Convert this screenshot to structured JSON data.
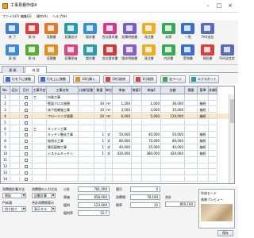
{
  "window": {
    "title": "工事見積作成4",
    "controls": {
      "minimize": "–",
      "maximize": "□",
      "close": "×"
    }
  },
  "menu": [
    "ファイル(F)",
    "編集(E)",
    "操作(A)",
    "ヘルプ(H)"
  ],
  "toolbar": {
    "row1": [
      {
        "label": "終 了",
        "color": "#3f7fd0"
      },
      {
        "label": "保 存",
        "color": "#d84040"
      },
      {
        "label": "見積書",
        "color": "#e07828"
      },
      {
        "label": "見積送付",
        "color": "#2c9aa8"
      },
      {
        "label": "請求書",
        "color": "#3a8fd8"
      },
      {
        "label": "合計請求書",
        "color": "#d03c8c"
      },
      {
        "label": "見積明細書",
        "color": "#7a5cc8"
      },
      {
        "label": "発注書",
        "color": "#e8b020"
      },
      {
        "label": "封筒",
        "color": "#38a858"
      },
      {
        "label": "一覧",
        "color": "#3a6cc8"
      },
      {
        "label": "FAX送信",
        "color": "#5a6cb8"
      }
    ],
    "row2": [
      {
        "label": "表 紙",
        "color": "#3f88d8"
      },
      {
        "label": "保 存",
        "color": "#5aa838"
      },
      {
        "label": "見積書",
        "color": "#e09020"
      },
      {
        "label": "見積原価",
        "color": "#d84880"
      },
      {
        "label": "請求書",
        "color": "#2c9aa8"
      },
      {
        "label": "合計請求書",
        "color": "#c83c3c"
      },
      {
        "label": "請求明細書",
        "color": "#8a5cc8"
      },
      {
        "label": "発注書",
        "color": "#e8b020"
      },
      {
        "label": "内訳書",
        "color": "#38a858"
      },
      {
        "label": "受領書",
        "color": "#3a6cc8"
      },
      {
        "label": "領収書",
        "color": "#d84040"
      },
      {
        "label": "FAX送信状",
        "color": "#5a6cb8"
      }
    ]
  },
  "tabs": [
    "表 紙",
    "内 容"
  ],
  "active_tab_index": 1,
  "actions": [
    {
      "label": "行を下に移動",
      "icon_color": "#3a70c8"
    },
    {
      "label": "行を上に移動",
      "icon_color": "#3a70c8"
    },
    {
      "label": "10行挿入",
      "icon_color": "#e09020"
    },
    {
      "label": "10行削除",
      "icon_color": "#d84040"
    },
    {
      "label": "1行削除",
      "icon_color": "#d84040"
    },
    {
      "label": "次ページ",
      "icon_color": "#38a858"
    },
    {
      "label": "エクスポート",
      "icon_color": "#2c9aa8"
    }
  ],
  "grid": {
    "headers": [
      "No.",
      "区分",
      "日付",
      "工事予定",
      "工事名称",
      "仕様/型番",
      "数量",
      "単位",
      "単価",
      "数量2",
      "単価2",
      "金額",
      "摘要",
      "基準",
      "非課税"
    ],
    "rows": [
      {
        "no": "1",
        "kubun": "",
        "cat": "工",
        "name": "内装工事",
        "spec": "",
        "qty": "",
        "unit": "",
        "price": "",
        "qty2": "",
        "price2": "",
        "amount": "",
        "note": "",
        "std": "",
        "tax": ""
      },
      {
        "no": "2",
        "kubun": "",
        "cat": "",
        "name": "壁面クロス張替",
        "spec": "",
        "qty": "30",
        "unit": "m²",
        "price": "1,200",
        "qty2": "",
        "price2": "1,000",
        "amount": "36,000",
        "note": "",
        "std": "継続",
        "tax": ""
      },
      {
        "no": "3",
        "kubun": "",
        "cat": "",
        "name": "床下地補強工事",
        "spec": "",
        "qty": "10",
        "unit": "m²",
        "price": "3,500",
        "qty2": "",
        "price2": "3,000",
        "amount": "35,000",
        "note": "",
        "std": "継続",
        "tax": ""
      },
      {
        "no": "4",
        "kubun": "",
        "cat": "",
        "name": "フローリング張替",
        "spec": "",
        "qty": "20",
        "unit": "m²",
        "price": "6,000",
        "qty2": "",
        "price2": "5,000",
        "amount": "120,000",
        "note": "",
        "std": "継続",
        "tax": ""
      },
      {
        "no": "5",
        "kubun": "",
        "cat": "",
        "name": "",
        "spec": "",
        "qty": "",
        "unit": "",
        "price": "",
        "qty2": "",
        "price2": "",
        "amount": "",
        "note": "",
        "std": "",
        "tax": ""
      },
      {
        "no": "6",
        "kubun": "",
        "cat": "工",
        "name": "キッチン工事",
        "spec": "",
        "qty": "",
        "unit": "",
        "price": "",
        "qty2": "",
        "price2": "",
        "amount": "",
        "note": "",
        "std": "",
        "tax": ""
      },
      {
        "no": "7",
        "kubun": "",
        "cat": "",
        "name": "キッチン撤去工事",
        "spec": "",
        "qty": "1",
        "unit": "式",
        "price": "50,000",
        "qty2": "",
        "price2": "40,000",
        "amount": "50,000",
        "note": "",
        "std": "継続",
        "tax": ""
      },
      {
        "no": "8",
        "kubun": "",
        "cat": "",
        "name": "給排水工事",
        "spec": "",
        "qty": "1",
        "unit": "式",
        "price": "80,000",
        "qty2": "",
        "price2": "70,000",
        "amount": "80,000",
        "note": "",
        "std": "継続",
        "tax": ""
      },
      {
        "no": "9",
        "kubun": "",
        "cat": "",
        "name": "電気配線工事",
        "spec": "",
        "qty": "1",
        "unit": "式",
        "price": "40,000",
        "qty2": "",
        "price2": "35,000",
        "amount": "40,000",
        "note": "",
        "std": "継続",
        "tax": ""
      },
      {
        "no": "10",
        "kubun": "",
        "cat": "",
        "name": "システムキッチン",
        "spec": "",
        "qty": "1",
        "unit": "式",
        "price": "420,000",
        "qty2": "",
        "price2": "380,000",
        "amount": "420,000",
        "note": "",
        "std": "継続",
        "tax": ""
      },
      {
        "no": "11",
        "kubun": "",
        "cat": "",
        "name": "",
        "spec": "",
        "qty": "",
        "unit": "",
        "price": "",
        "qty2": "",
        "price2": "",
        "amount": "",
        "note": "",
        "std": "",
        "tax": ""
      },
      {
        "no": "12",
        "kubun": "",
        "cat": "",
        "name": "",
        "spec": "",
        "qty": "",
        "unit": "",
        "price": "",
        "qty2": "",
        "price2": "",
        "amount": "",
        "note": "",
        "std": "",
        "tax": ""
      },
      {
        "no": "13",
        "kubun": "",
        "cat": "",
        "name": "",
        "spec": "",
        "qty": "",
        "unit": "",
        "price": "",
        "qty2": "",
        "price2": "",
        "amount": "",
        "note": "",
        "std": "",
        "tax": ""
      },
      {
        "no": "14",
        "kubun": "",
        "cat": "",
        "name": "",
        "spec": "",
        "qty": "",
        "unit": "",
        "price": "",
        "qty2": "",
        "price2": "",
        "amount": "",
        "note": "",
        "std": "",
        "tax": ""
      }
    ],
    "highlight_row_index": 3
  },
  "bottom": {
    "tax_calc_label": "消費税計算方法",
    "tax_calc_value": "税抜",
    "rounding_label": "円未満",
    "rounding_value": "切り捨て",
    "tax_input_label": "消費税の入力方法",
    "tax_input_value": "自動計算",
    "tax_display_label": "合計消費税表示",
    "tax_display_value": "表示する",
    "subtotal_label": "小計",
    "subtotal_value": "781,000",
    "tax_label": "消費税",
    "tax_value": "78,100",
    "total_label": "合計",
    "total_value": "859,100",
    "rate_label": "税率",
    "rate_value": "10",
    "cost_label": "原価",
    "cost_value": "658,000",
    "profit_label": "粗利",
    "profit_value": "123,000",
    "discount_label": "値引",
    "discount_value": "0",
    "profit_rate_label": "粗利率",
    "profit_rate_value": "15.7",
    "memo_label": "作成モード",
    "preview_label": "画像プレビュー",
    "save_label": "保存"
  }
}
